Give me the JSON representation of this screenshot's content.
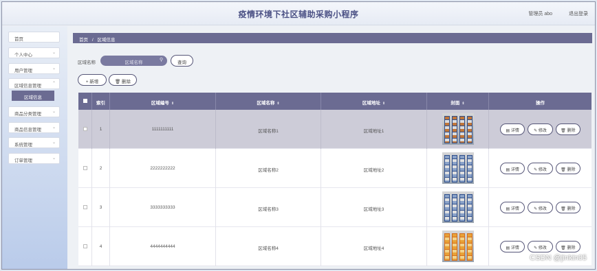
{
  "header": {
    "title": "疫情环境下社区辅助采购小程序",
    "user_label": "管理员 abo",
    "logout_label": "退出登录"
  },
  "sidebar": {
    "items": [
      {
        "label": "首页",
        "has_chevron": false
      },
      {
        "label": "个人中心",
        "has_chevron": true
      },
      {
        "label": "用户管理",
        "has_chevron": true
      },
      {
        "label": "区域信息管理",
        "has_chevron": true
      },
      {
        "label": "商品分类管理",
        "has_chevron": true
      },
      {
        "label": "商品信息管理",
        "has_chevron": true
      },
      {
        "label": "系统管理",
        "has_chevron": true
      },
      {
        "label": "订单管理",
        "has_chevron": true
      }
    ],
    "active_sub": "区域信息"
  },
  "breadcrumb": {
    "home": "首页",
    "sep": "/",
    "current": "区域信息"
  },
  "search": {
    "label": "区域名称",
    "placeholder": "区域名称",
    "query_button": "查询"
  },
  "toolbar": {
    "add_label": "+ 新增",
    "delete_label": "删除"
  },
  "table": {
    "headers": {
      "index": "索引",
      "code": "区域编号",
      "name": "区域名称",
      "address": "区域地址",
      "image": "封面",
      "actions": "操作"
    },
    "sort_icon": "⇕",
    "rows": [
      {
        "index": "1",
        "code": "1111111111",
        "name": "区域名称1",
        "address": "区域地址1",
        "image_style": "orange-blue",
        "selected": true
      },
      {
        "index": "2",
        "code": "2222222222",
        "name": "区域名称2",
        "address": "区域地址2",
        "image_style": "blue",
        "selected": false
      },
      {
        "index": "3",
        "code": "3333333333",
        "name": "区域名称3",
        "address": "区域地址3",
        "image_style": "blue",
        "selected": false
      },
      {
        "index": "4",
        "code": "4444444444",
        "name": "区域名称4",
        "address": "区域地址4",
        "image_style": "orange",
        "selected": false
      }
    ],
    "actions": {
      "detail": "详情",
      "edit": "修改",
      "delete": "删除"
    }
  },
  "watermark": "CSDN @jinkin05",
  "colors": {
    "accent": "#6b6b92",
    "title": "#4a5084",
    "selected_row": "#cdccd8"
  }
}
